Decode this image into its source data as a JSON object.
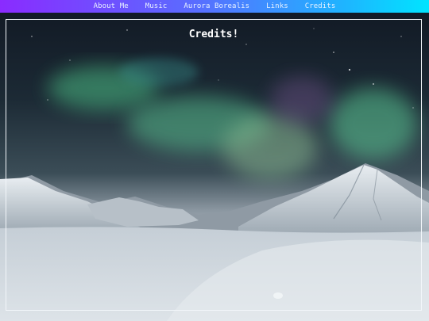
{
  "nav": {
    "items": [
      {
        "label": "About Me"
      },
      {
        "label": "Music"
      },
      {
        "label": "Aurora Borealis"
      },
      {
        "label": "Links"
      },
      {
        "label": "Credits"
      }
    ]
  },
  "content": {
    "heading": "Credits!"
  },
  "colors": {
    "nav_gradient_start": "#8a2bff",
    "nav_gradient_end": "#00e4ff",
    "frame_border": "#f2f6fa",
    "aurora": "#5fd39a"
  }
}
